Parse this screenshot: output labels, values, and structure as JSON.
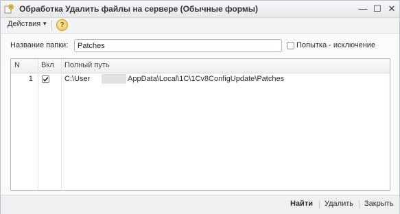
{
  "window": {
    "title": "Обработка  Удалить файлы на сервере (Обычные формы)",
    "controls": {
      "minimize": "—",
      "maximize": "☐",
      "close": "✕"
    }
  },
  "toolbar": {
    "actions_label": "Действия",
    "help_symbol": "?"
  },
  "form": {
    "folder_label": "Название папки:",
    "folder_value": "Patches",
    "try_catch_label": "Попытка - исключение",
    "try_catch_checked": false
  },
  "table": {
    "columns": [
      "N",
      "Вкл",
      "Полный путь"
    ],
    "rows": [
      {
        "n": "1",
        "enabled": true,
        "path_start": "C:\\User",
        "path_end": "AppData\\Local\\1C\\1Cv8ConfigUpdate\\Patches"
      }
    ]
  },
  "footer": {
    "find_label": "Найти",
    "delete_label": "Удалить",
    "close_label": "Закрыть"
  },
  "colors": {
    "accent_border": "#a9b7c6",
    "help_icon": "#f0b93a"
  }
}
